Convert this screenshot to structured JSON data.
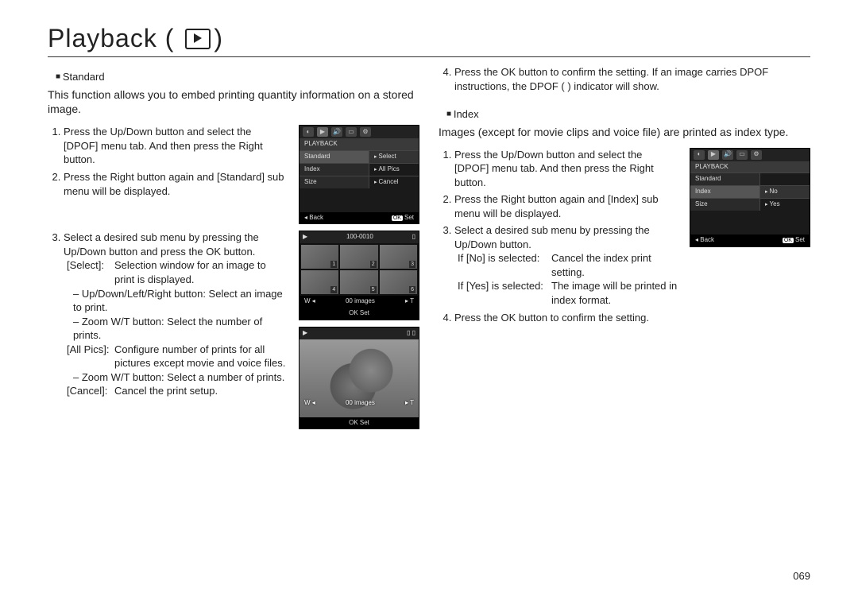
{
  "title": "Playback (",
  "title_close": ")",
  "page_number": "069",
  "left": {
    "heading": "Standard",
    "intro": "This function allows you to embed printing quantity information on a stored image.",
    "step1": "Press the Up/Down button and select the [DPOF] menu tab. And then press the Right button.",
    "step2": "Press the Right button again and [Standard] sub menu will be displayed.",
    "step3_lead": "Select a desired sub menu by pressing the Up/Down button and press the OK button.",
    "select_label": "[Select]:",
    "select_text": "Selection window for an image to print is displayed.",
    "select_sub1": "Up/Down/Left/Right button: Select an image to print.",
    "select_sub2": "Zoom W/T button: Select the number of prints.",
    "allpics_label": "[All Pics]:",
    "allpics_text": "Configure number of prints for all pictures except movie and voice files.",
    "allpics_sub1": "Zoom W/T button:   Select a number of prints.",
    "cancel_label": "[Cancel]:",
    "cancel_text": "Cancel the print setup."
  },
  "right": {
    "step4": "Press the OK button to confirm the setting. If an image carries DPOF instructions, the DPOF (    ) indicator will show.",
    "heading": "Index",
    "intro": "Images (except for movie clips and voice file) are printed as index type.",
    "step1": "Press the Up/Down button and select the [DPOF] menu tab. And then press the Right button.",
    "step2": "Press the Right button again and [Index] sub menu will be displayed.",
    "step3_lead": "Select a desired sub menu by pressing the Up/Down button.",
    "no_label": "If [No] is selected:",
    "no_text": "Cancel the index print setting.",
    "yes_label": "If [Yes] is selected:",
    "yes_text": "The image will be printed in index format.",
    "step4b": "Press the OK button to confirm the setting."
  },
  "screen1": {
    "title": "PLAYBACK",
    "r1l": "Standard",
    "r1r": "Select",
    "r2l": "Index",
    "r2r": "All Pics",
    "r3l": "Size",
    "r3r": "Cancel",
    "back": "Back",
    "ok": "OK",
    "set": "Set"
  },
  "screen2": {
    "counter": "100-0010",
    "w": "W",
    "t": "T",
    "mid": "00 images",
    "ok": "OK",
    "set": "Set"
  },
  "screen3": {
    "w": "W",
    "t": "T",
    "mid": "00 images",
    "ok": "OK",
    "set": "Set"
  },
  "screen4": {
    "title": "PLAYBACK",
    "r1l": "Standard",
    "r1r": "",
    "r2l": "Index",
    "r2r": "No",
    "r3l": "Size",
    "r3r": "Yes",
    "back": "Back",
    "ok": "OK",
    "set": "Set"
  }
}
